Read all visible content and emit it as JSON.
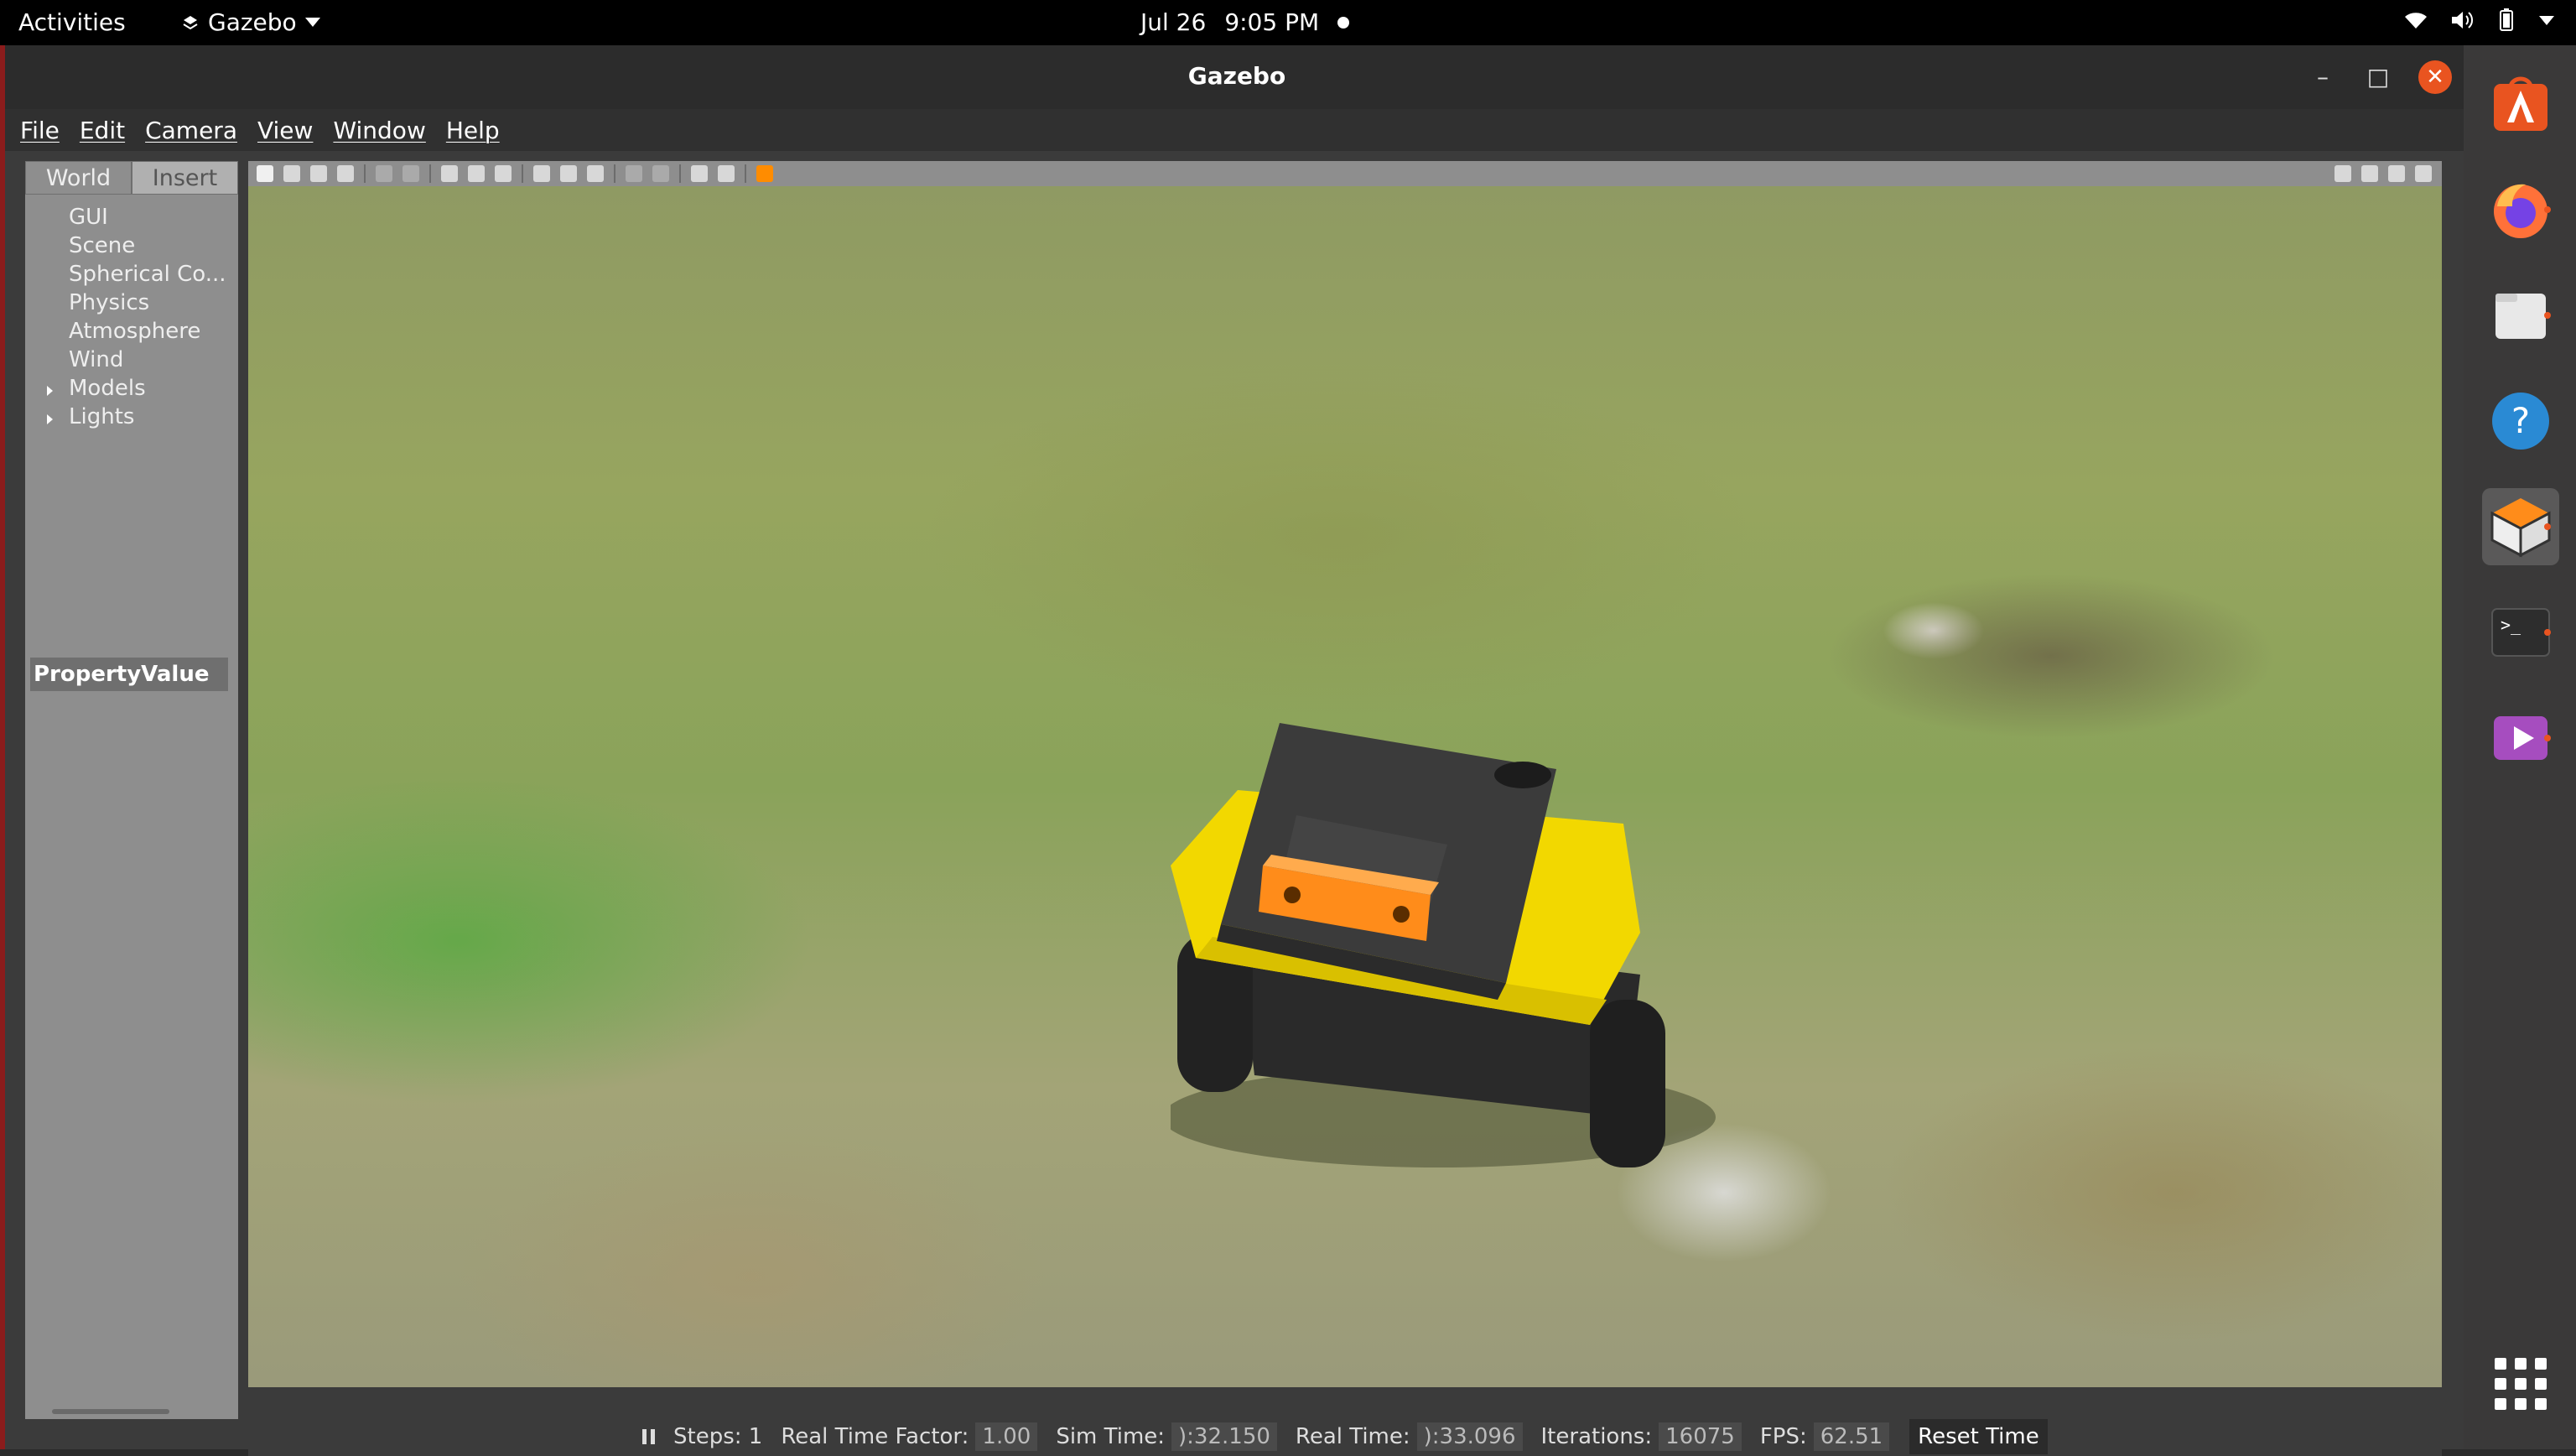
{
  "topbar": {
    "activities": "Activities",
    "app_name": "Gazebo",
    "date": "Jul 26",
    "time": "9:05 PM"
  },
  "window": {
    "title": "Gazebo",
    "menu": [
      "File",
      "Edit",
      "Camera",
      "View",
      "Window",
      "Help"
    ]
  },
  "left_panel": {
    "tabs": [
      "World",
      "Insert"
    ],
    "tree": [
      "GUI",
      "Scene",
      "Spherical Co...",
      "Physics",
      "Atmosphere",
      "Wind",
      "Models",
      "Lights"
    ],
    "property_header": "PropertyValue"
  },
  "statusbar": {
    "steps_label": "Steps: 1",
    "rtf_label": "Real Time Factor:",
    "rtf_value": "1.00",
    "sim_time_label": "Sim Time:",
    "sim_time_value": "):32.150",
    "real_time_label": "Real Time:",
    "real_time_value": "):33.096",
    "iterations_label": "Iterations:",
    "iterations_value": "16075",
    "fps_label": "FPS:",
    "fps_value": "62.51",
    "reset_label": "Reset Time"
  },
  "dock": {
    "items": [
      "software-center-icon",
      "firefox-icon",
      "files-icon",
      "help-icon",
      "gazebo-icon",
      "terminal-icon",
      "media-player-icon"
    ]
  },
  "colors": {
    "accent": "#e95420",
    "robot_body": "#ffd400",
    "robot_top": "#3a3a3a",
    "sensor": "#ff8c1a"
  }
}
